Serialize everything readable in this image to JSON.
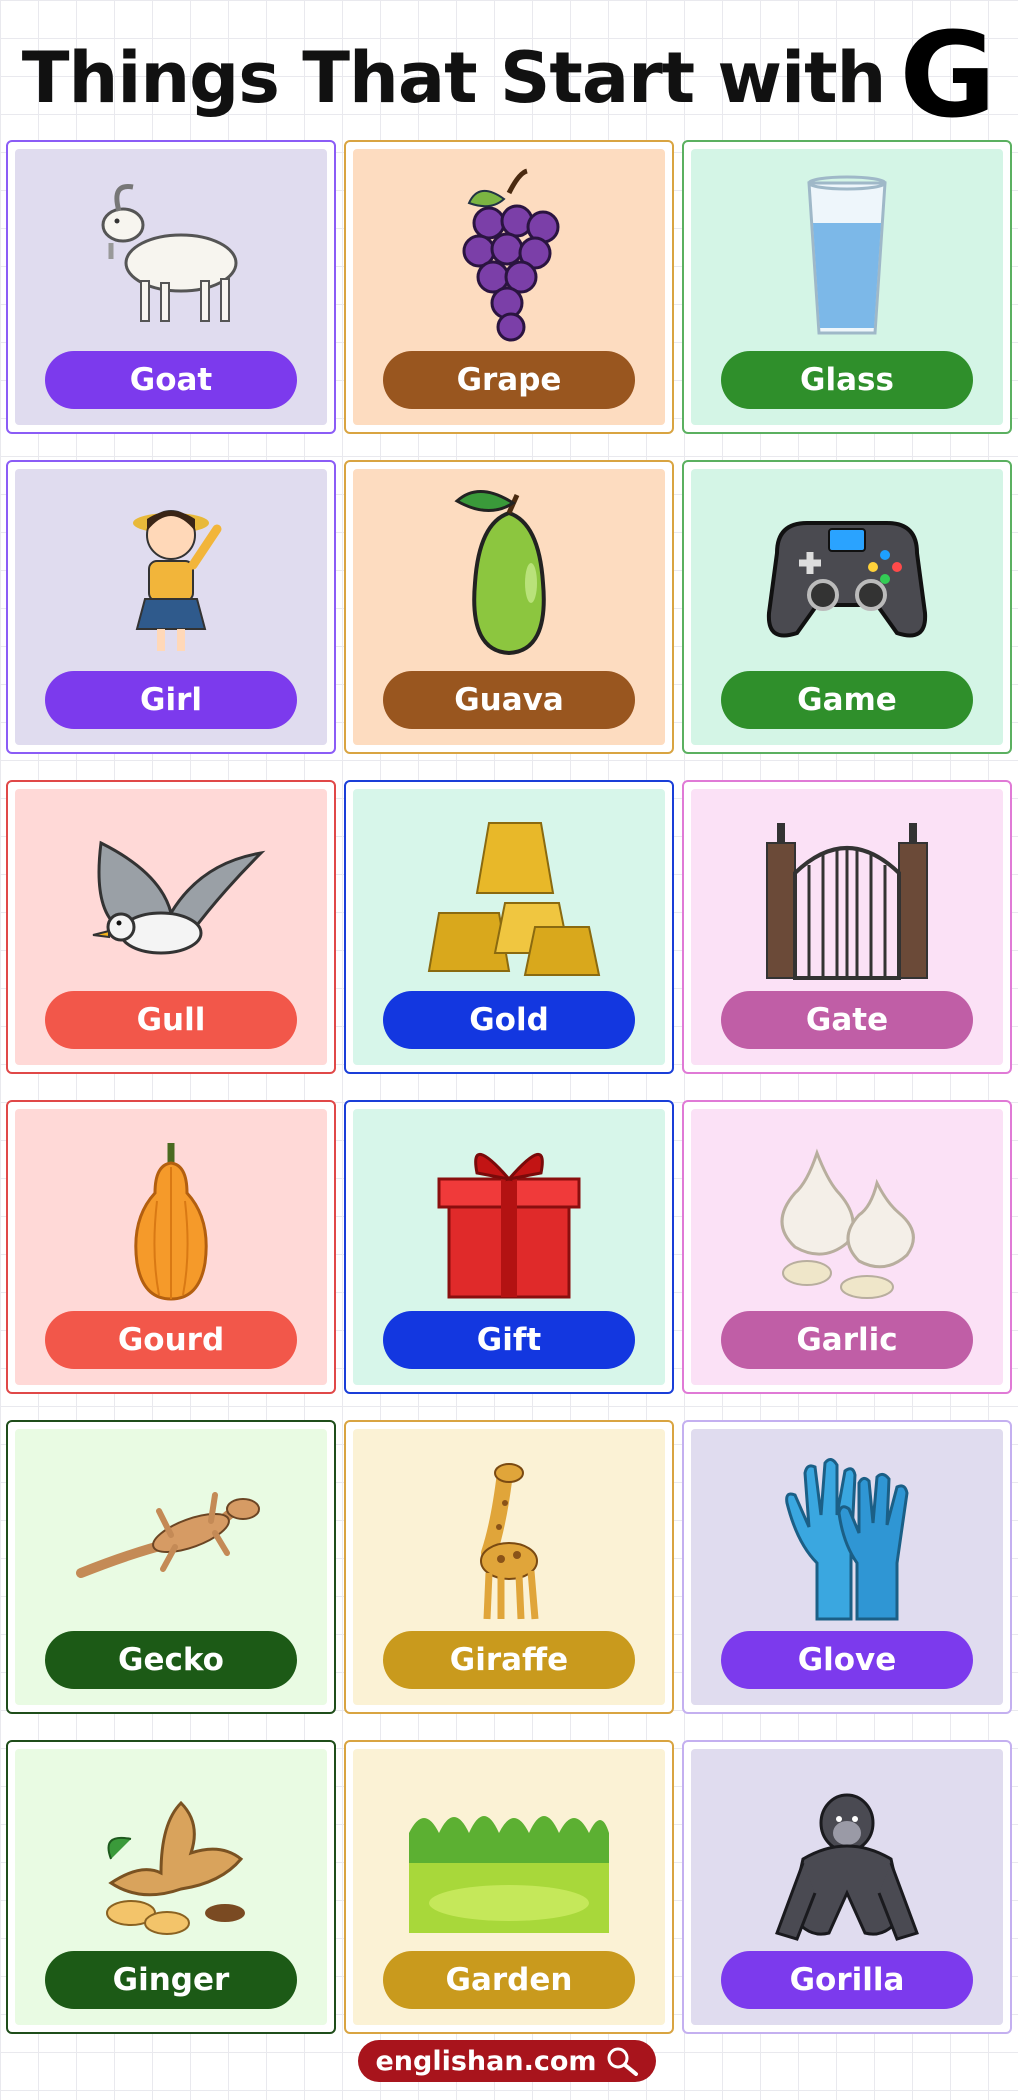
{
  "title": {
    "text": "Things That Start with",
    "letter": "G"
  },
  "items": [
    {
      "label": "Goat",
      "icon": "goat-icon",
      "border": "#8b5cf6",
      "bg": "#e0dcef",
      "pill": "#7c3aed"
    },
    {
      "label": "Grape",
      "icon": "grape-icon",
      "border": "#d9a441",
      "bg": "#fddcc0",
      "pill": "#99561f"
    },
    {
      "label": "Glass",
      "icon": "glass-icon",
      "border": "#5bb060",
      "bg": "#d4f5e6",
      "pill": "#2f8f2b"
    },
    {
      "label": "Girl",
      "icon": "girl-icon",
      "border": "#8b5cf6",
      "bg": "#e0dcef",
      "pill": "#7c3aed"
    },
    {
      "label": "Guava",
      "icon": "guava-icon",
      "border": "#d9a441",
      "bg": "#fddcc0",
      "pill": "#99561f"
    },
    {
      "label": "Game",
      "icon": "gamepad-icon",
      "border": "#5bb060",
      "bg": "#d4f5e6",
      "pill": "#2f8f2b"
    },
    {
      "label": "Gull",
      "icon": "gull-icon",
      "border": "#e04848",
      "bg": "#ffd9d7",
      "pill": "#f2574a"
    },
    {
      "label": "Gold",
      "icon": "gold-bars-icon",
      "border": "#1a3ed8",
      "bg": "#d7f6ea",
      "pill": "#1337e0"
    },
    {
      "label": "Gate",
      "icon": "gate-icon",
      "border": "#e07ad6",
      "bg": "#fbe1f6",
      "pill": "#c05ea6"
    },
    {
      "label": "Gourd",
      "icon": "gourd-icon",
      "border": "#e04848",
      "bg": "#ffd9d7",
      "pill": "#f2574a"
    },
    {
      "label": "Gift",
      "icon": "gift-icon",
      "border": "#1a3ed8",
      "bg": "#d7f6ea",
      "pill": "#1337e0"
    },
    {
      "label": "Garlic",
      "icon": "garlic-icon",
      "border": "#e07ad6",
      "bg": "#fbe1f6",
      "pill": "#c05ea6"
    },
    {
      "label": "Gecko",
      "icon": "gecko-icon",
      "border": "#1f4d1a",
      "bg": "#e9fbe3",
      "pill": "#1c5a16"
    },
    {
      "label": "Giraffe",
      "icon": "giraffe-icon",
      "border": "#d9a441",
      "bg": "#fbf2d5",
      "pill": "#c99a1d"
    },
    {
      "label": "Glove",
      "icon": "glove-icon",
      "border": "#c4b0f0",
      "bg": "#e0dcef",
      "pill": "#7c3aed"
    },
    {
      "label": "Ginger",
      "icon": "ginger-icon",
      "border": "#1f4d1a",
      "bg": "#e9fbe3",
      "pill": "#1c5a16"
    },
    {
      "label": "Garden",
      "icon": "garden-icon",
      "border": "#d9a441",
      "bg": "#fbf2d5",
      "pill": "#c99a1d"
    },
    {
      "label": "Gorilla",
      "icon": "gorilla-icon",
      "border": "#c4b0f0",
      "bg": "#e0dcef",
      "pill": "#7c3aed"
    }
  ],
  "footer": {
    "text": "englishan.com",
    "icon": "search-icon"
  }
}
